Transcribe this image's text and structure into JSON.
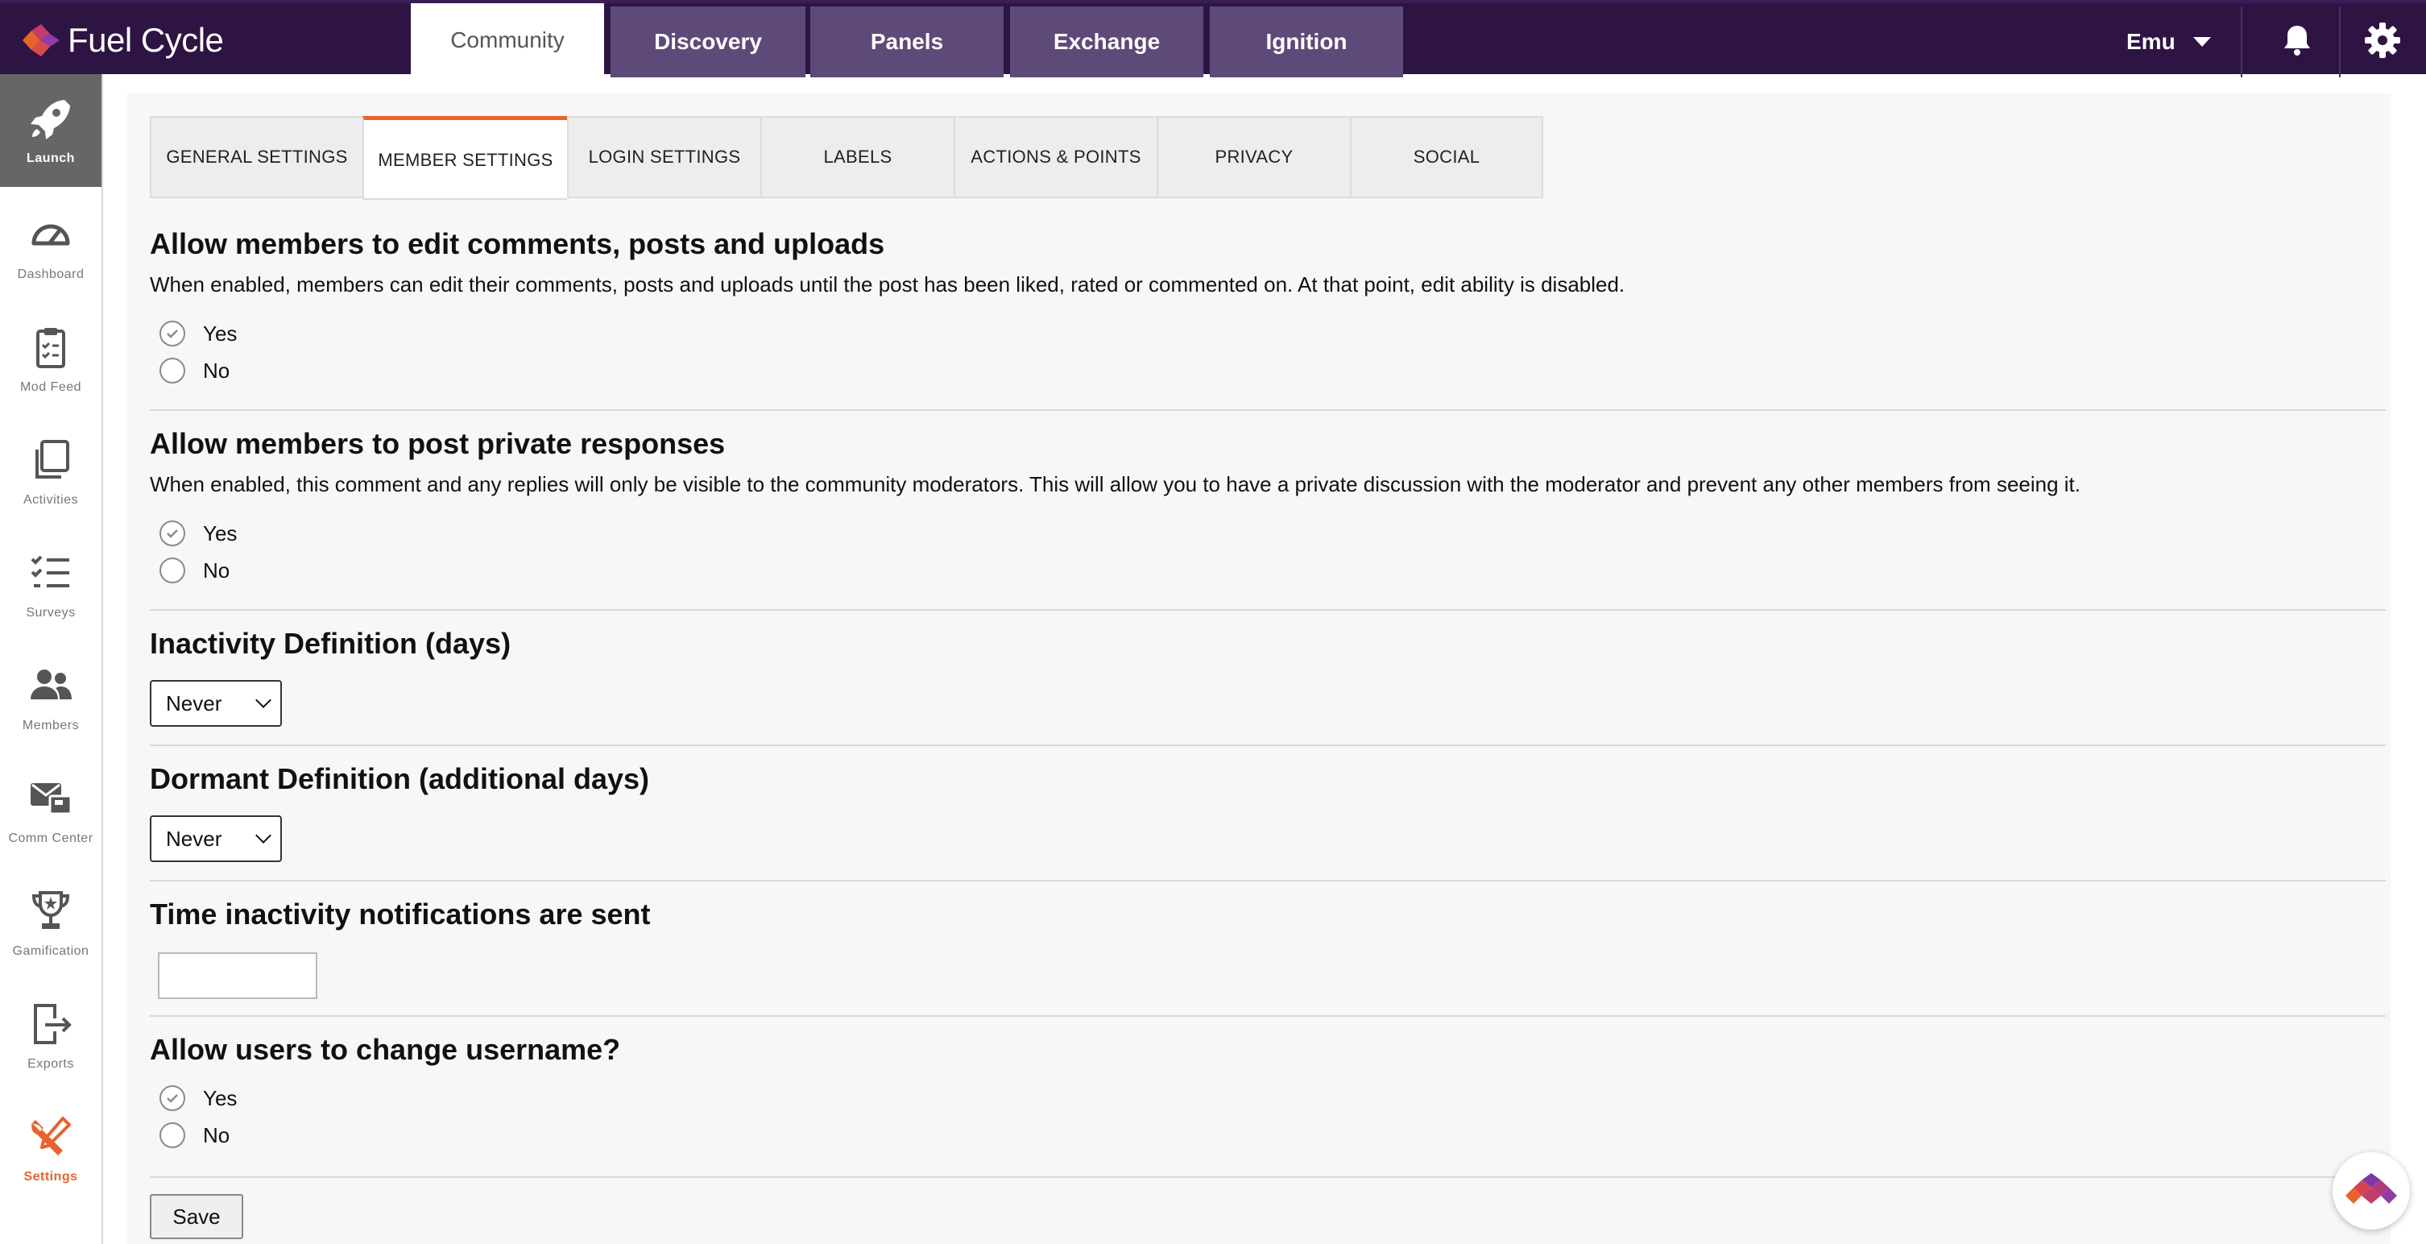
{
  "app": {
    "logo_text": "Fuel Cycle",
    "user_name": "Emu"
  },
  "colors": {
    "topbar": "#2e1443",
    "nav_tab": "#5e4a78",
    "accent": "#e8632c",
    "sidebar_active": "#666666"
  },
  "top_nav": [
    {
      "label": "Community",
      "active": true
    },
    {
      "label": "Discovery",
      "active": false
    },
    {
      "label": "Panels",
      "active": false
    },
    {
      "label": "Exchange",
      "active": false
    },
    {
      "label": "Ignition",
      "active": false
    }
  ],
  "top_icons": [
    "bell-icon",
    "gear-icon"
  ],
  "sidebar": [
    {
      "label": "Launch",
      "icon": "rocket-icon",
      "active": true
    },
    {
      "label": "Dashboard",
      "icon": "gauge-icon"
    },
    {
      "label": "Mod Feed",
      "icon": "clipboard-icon"
    },
    {
      "label": "Activities",
      "icon": "copy-icon"
    },
    {
      "label": "Surveys",
      "icon": "checklist-icon"
    },
    {
      "label": "Members",
      "icon": "users-icon"
    },
    {
      "label": "Comm Center",
      "icon": "mail-icon"
    },
    {
      "label": "Gamification",
      "icon": "trophy-icon"
    },
    {
      "label": "Exports",
      "icon": "export-icon"
    },
    {
      "label": "Settings",
      "icon": "tools-icon",
      "highlight": true
    }
  ],
  "settings_tabs": [
    {
      "label": "GENERAL SETTINGS"
    },
    {
      "label": "MEMBER SETTINGS",
      "active": true
    },
    {
      "label": "LOGIN SETTINGS"
    },
    {
      "label": "LABELS"
    },
    {
      "label": "ACTIONS & POINTS"
    },
    {
      "label": "PRIVACY"
    },
    {
      "label": "SOCIAL"
    }
  ],
  "sections": {
    "edit_comments": {
      "title": "Allow members to edit comments, posts and uploads",
      "description": "When enabled, members can edit their comments, posts and uploads until the post has been liked, rated or commented on. At that point, edit ability is disabled.",
      "options": [
        "Yes",
        "No"
      ],
      "selected": "Yes"
    },
    "private_responses": {
      "title": "Allow members to post private responses",
      "description": "When enabled, this comment and any replies will only be visible to the community moderators. This will allow you to have a private discussion with the moderator and prevent any other members from seeing it.",
      "options": [
        "Yes",
        "No"
      ],
      "selected": "Yes"
    },
    "inactivity": {
      "title": "Inactivity Definition (days)",
      "value": "Never"
    },
    "dormant": {
      "title": "Dormant Definition (additional days)",
      "value": "Never"
    },
    "notification_time": {
      "title": "Time inactivity notifications are sent",
      "value": ""
    },
    "change_username": {
      "title": "Allow users to change username?",
      "options": [
        "Yes",
        "No"
      ],
      "selected": "Yes"
    }
  },
  "save_label": "Save"
}
